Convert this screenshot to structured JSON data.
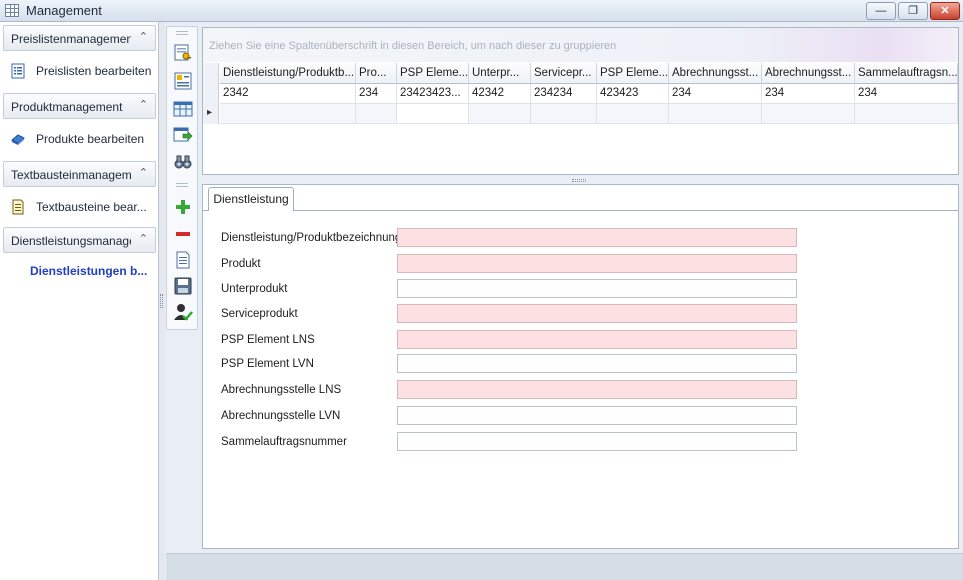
{
  "window": {
    "title": "Management",
    "minimize_glyph": "—",
    "restore_glyph": "❐",
    "close_glyph": "✕"
  },
  "sidebar": {
    "groups": [
      {
        "header": "Preislistenmanagement",
        "item": "Preislisten bearbeiten",
        "icon": "list-document-icon"
      },
      {
        "header": "Produktmanagement",
        "item": "Produkte bearbeiten",
        "icon": "product-box-icon"
      },
      {
        "header": "Textbausteinmanagement",
        "item": "Textbausteine bear...",
        "icon": "note-icon"
      },
      {
        "header": "Dienstleistungsmanagement",
        "item": "Dienstleistungen b...",
        "icon": ""
      }
    ],
    "chevron": "⌃"
  },
  "toolbar": {
    "icons": [
      "key-edit-icon",
      "form-view-icon",
      "column-chooser-icon",
      "export-icon",
      "binoculars-icon",
      "add-icon",
      "remove-icon",
      "document-icon",
      "save-icon",
      "user-check-icon"
    ]
  },
  "grid": {
    "group_panel_text": "Ziehen Sie eine Spaltenüberschrift in diesen Bereich, um nach dieser zu gruppieren",
    "columns": [
      "Dienstleistung/Produktb...",
      "Pro...",
      "PSP Eleme...",
      "Unterpr...",
      "Servicepr...",
      "PSP Eleme...",
      "Abrechnungsst...",
      "Abrechnungsst...",
      "Sammelauftragsn..."
    ],
    "rows": [
      [
        "2342",
        "234",
        "23423423...",
        "42342",
        "234234",
        "423423",
        "234",
        "234",
        "234"
      ]
    ],
    "new_row_indicator": "▸"
  },
  "detail": {
    "tab_label": "Dienstleistung",
    "fields": [
      {
        "label": "Dienstleistung/Produktbezeichnung",
        "value": "",
        "required": true
      },
      {
        "label": "Produkt",
        "value": "",
        "required": true
      },
      {
        "label": "Unterprodukt",
        "value": "",
        "required": false
      },
      {
        "label": "Serviceprodukt",
        "value": "",
        "required": true
      },
      {
        "label": "PSP Element LNS",
        "value": "",
        "required": true
      },
      {
        "label": "PSP Element LVN",
        "value": "",
        "required": false
      },
      {
        "label": "Abrechnungsstelle LNS",
        "value": "",
        "required": true
      },
      {
        "label": "Abrechnungsstelle LVN",
        "value": "",
        "required": false
      },
      {
        "label": "Sammelauftragsnummer",
        "value": "",
        "required": false
      }
    ]
  },
  "colors": {
    "required_field": "#fde0e1",
    "active_nav": "#1f3fbf",
    "accent_border": "#aab7c7"
  }
}
